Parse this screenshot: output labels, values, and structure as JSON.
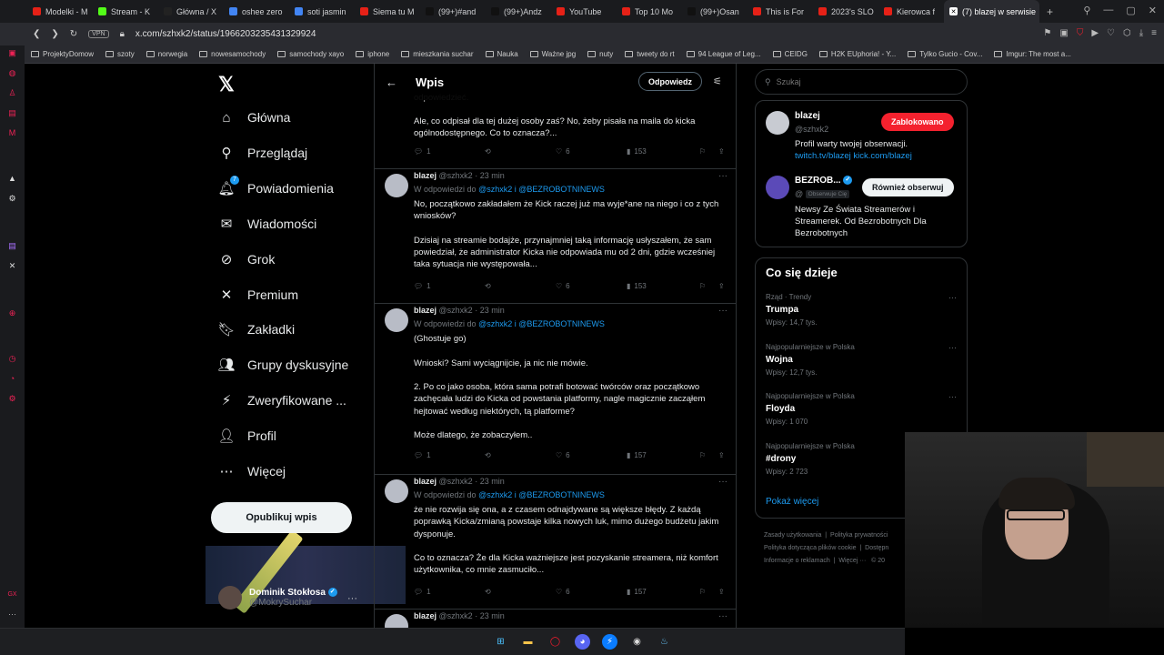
{
  "browser": {
    "tabs": [
      {
        "label": "Modelki - M",
        "color": "#e62117"
      },
      {
        "label": "Stream - K",
        "color": "#53fc18"
      },
      {
        "label": "Główna / X",
        "color": "#222222"
      },
      {
        "label": "oshee zero",
        "color": "#4285f4"
      },
      {
        "label": "soti jasmin",
        "color": "#4285f4"
      },
      {
        "label": "Siema tu M",
        "color": "#e62117"
      },
      {
        "label": "(99+)#and",
        "color": "#111111"
      },
      {
        "label": "(99+)Andz",
        "color": "#111111"
      },
      {
        "label": "YouTube",
        "color": "#e62117"
      },
      {
        "label": "Top 10 Mo",
        "color": "#e62117"
      },
      {
        "label": "(99+)Osan",
        "color": "#111111"
      },
      {
        "label": "This is For",
        "color": "#e62117"
      },
      {
        "label": "2023's SLO",
        "color": "#e62117"
      },
      {
        "label": "Kierowca f",
        "color": "#e62117"
      }
    ],
    "active_tab": "(7) blazej w serwisie",
    "vpn": "VPN",
    "url": "x.com/szhxk2/status/1966203235431329924",
    "bookmarks": [
      "ProjektyDomow",
      "szoty",
      "norwegia",
      "nowesamochody",
      "samochody xayo",
      "iphone",
      "mieszkania suchar",
      "Nauka",
      "Ważne jpg",
      "nuty",
      "tweety do rt",
      "94 League of Leg...",
      "CEIDG",
      "H2K EUphoria! - Y...",
      "Tylko Gucio - Cov...",
      "Imgur: The most a..."
    ]
  },
  "nav": {
    "items": [
      {
        "label": "Główna",
        "icon": "home-icon",
        "glyph": "⌂"
      },
      {
        "label": "Przeglądaj",
        "icon": "search-icon",
        "glyph": "⚲"
      },
      {
        "label": "Powiadomienia",
        "icon": "bell-icon",
        "glyph": "🔔︎"
      },
      {
        "label": "Wiadomości",
        "icon": "mail-icon",
        "glyph": "✉"
      },
      {
        "label": "Grok",
        "icon": "grok-icon",
        "glyph": "⊘"
      },
      {
        "label": "Premium",
        "icon": "x-icon",
        "glyph": "✕"
      },
      {
        "label": "Zakładki",
        "icon": "bookmark-icon",
        "glyph": "🔖︎"
      },
      {
        "label": "Grupy dyskusyjne",
        "icon": "communities-icon",
        "glyph": "👥︎"
      },
      {
        "label": "Zweryfikowane ...",
        "icon": "lightning-icon",
        "glyph": "⚡︎"
      },
      {
        "label": "Profil",
        "icon": "profile-icon",
        "glyph": "👤︎"
      },
      {
        "label": "Więcej",
        "icon": "more-circle-icon",
        "glyph": "⋯"
      }
    ],
    "notification_badge": "7",
    "post_button": "Opublikuj wpis",
    "account_name": "Dominik Stokłosa",
    "account_handle": "@MokrySuchar"
  },
  "main": {
    "title": "Wpis",
    "reply_button": "Odpowiedz",
    "partial_top": "odpowiedzieć.",
    "first_text": "Ale, co odpisał dla tej dużej osoby zaś? No, żeby pisała na maila do kicka ogólnodostępnego. Co to oznacza?...",
    "first_actions": {
      "replies": "1",
      "likes": "6",
      "views": "153"
    },
    "tweets": [
      {
        "name": "blazej",
        "handle": "@szhxk2",
        "time": "23 min",
        "replying_prefix": "W odpowiedzi do",
        "replying_to": "@szhxk2 i @BEZROBOTNINEWS",
        "text": "No, początkowo zakładałem że Kick raczej już ma wyje*ane na niego i co z tych wniosków?\n\nDzisiaj na streamie bodajże, przynajmniej taką informację usłyszałem, że sam powiedział, że administrator Kicka nie odpowiada mu od 2 dni, gdzie wcześniej taka sytuacja nie występowała...",
        "replies": "1",
        "likes": "6",
        "views": "153"
      },
      {
        "name": "blazej",
        "handle": "@szhxk2",
        "time": "23 min",
        "replying_prefix": "W odpowiedzi do",
        "replying_to": "@szhxk2 i @BEZROBOTNINEWS",
        "text": "(Ghostuje go)\n\nWnioski? Sami wyciągnijcie, ja nic nie mówie.\n\n2. Po co jako osoba, która sama potrafi botować twórców oraz początkowo zachęcała ludzi do Kicka od powstania platformy, nagle magicznie zacząłem hejtować według niektórych, tą platforme?\n\nMoże dlatego, że zobaczyłem..",
        "replies": "1",
        "likes": "6",
        "views": "157"
      },
      {
        "name": "blazej",
        "handle": "@szhxk2",
        "time": "23 min",
        "replying_prefix": "W odpowiedzi do",
        "replying_to": "@szhxk2 i @BEZROBOTNINEWS",
        "text": "że nie rozwija się ona, a z czasem odnajdywane są większe błędy. Z każdą poprawką Kicka/zmianą powstaje kilka nowych luk, mimo dużego budżetu jakim dysponuje.\n\nCo to oznacza? Że dla Kicka ważniejsze jest pozyskanie streamera, niż komfort użytkownika, co mnie zasmuciło...",
        "replies": "1",
        "likes": "6",
        "views": "157"
      },
      {
        "name": "blazej",
        "handle": "@szhxk2",
        "time": "23 min"
      }
    ]
  },
  "right": {
    "search_placeholder": "Szukaj",
    "profile_card": {
      "name": "blazej",
      "handle": "@szhxk2",
      "blocked_button": "Zablokowano",
      "bio": "Profil warty twojej obserwacji.",
      "link": "twitch.tv/blazej kick.com/blazej"
    },
    "recommend": {
      "name": "BEZROB...",
      "handle": "@",
      "follows_you": "Obserwuje Cię",
      "follow_button": "Również obserwuj",
      "bio": "Newsy Ze Świata Streamerów i Streamerek. Od Bezrobotnych Dla Bezrobotnych"
    },
    "happening": {
      "title": "Co się dzieje",
      "trends": [
        {
          "context": "Rząd · Trendy",
          "name": "Trumpa",
          "count": "Wpisy: 14,7 tys."
        },
        {
          "context": "Najpopularniejsze w Polska",
          "name": "Wojna",
          "count": "Wpisy: 12,7 tys."
        },
        {
          "context": "Najpopularniejsze w Polska",
          "name": "Floyda",
          "count": "Wpisy: 1 070"
        },
        {
          "context": "Najpopularniejsze w Polska",
          "name": "#drony",
          "count": "Wpisy: 2 723"
        }
      ],
      "show_more": "Pokaż więcej"
    },
    "footer": {
      "terms": "Zasady użytkowania",
      "privacy": "Polityka prywatności",
      "cookies": "Polityka dotycząca plików cookie",
      "access": "Dostępn",
      "ads": "Informacje o reklamach",
      "more": "Więcej ···",
      "copy": "© 20"
    }
  },
  "colors": {
    "accent": "#1d9bf0",
    "blocked": "#f4212e"
  }
}
